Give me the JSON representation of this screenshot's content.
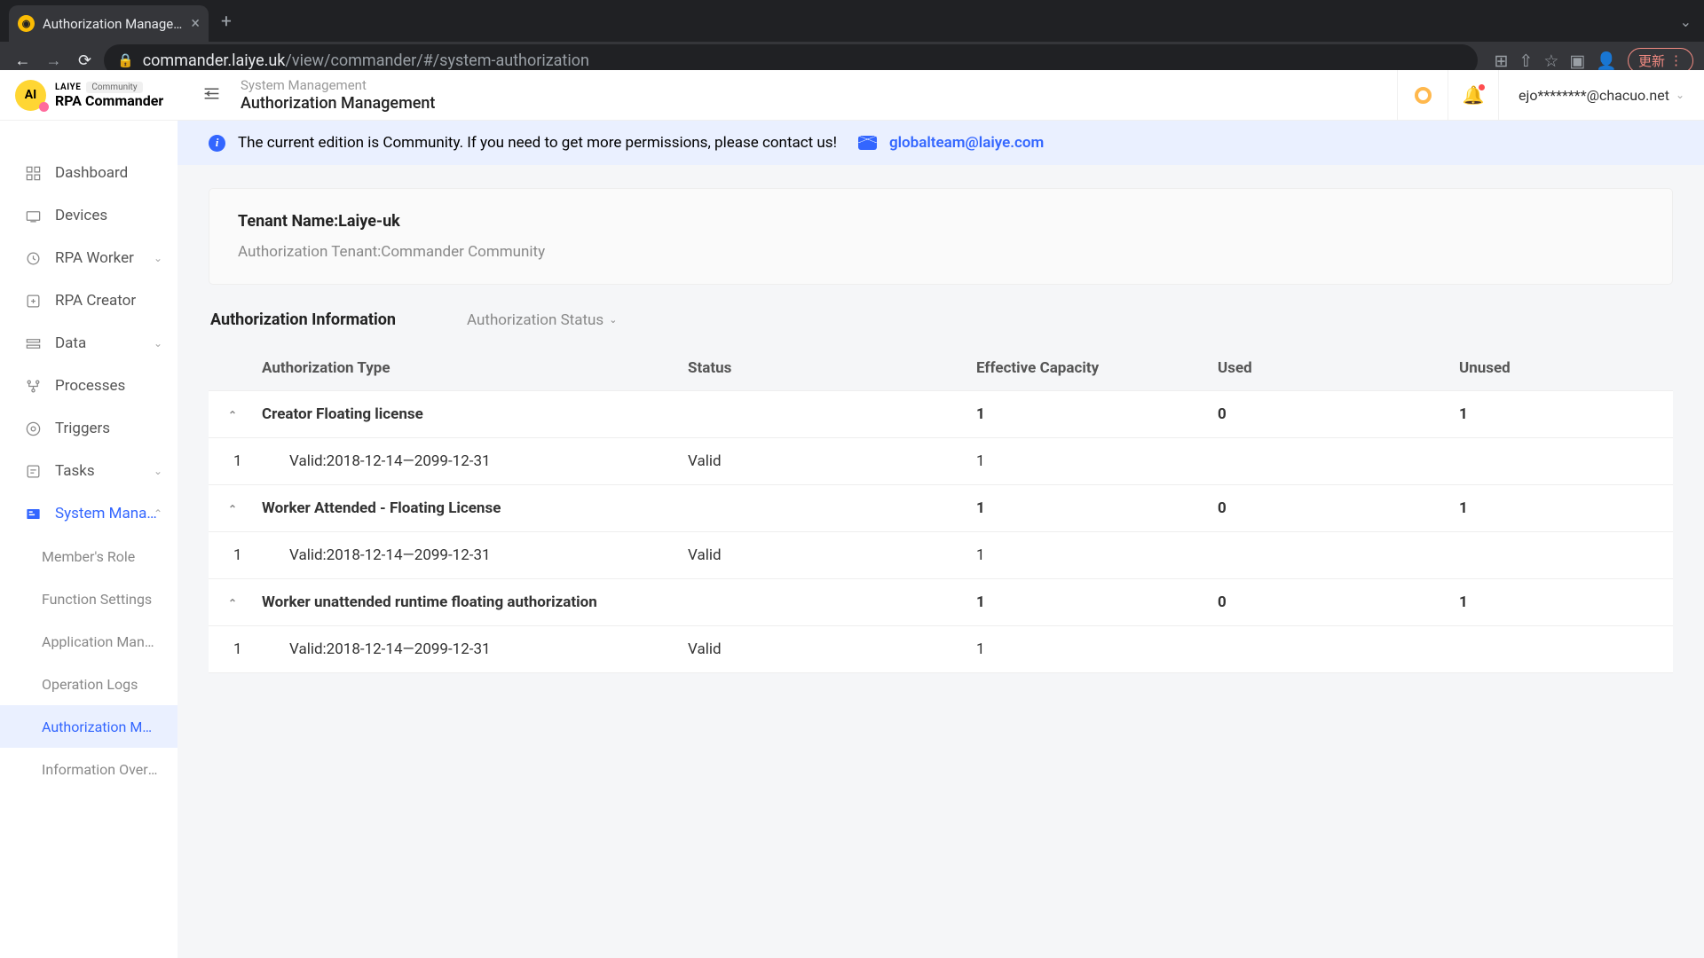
{
  "browser": {
    "tab_title": "Authorization Management_RP",
    "url_domain": "commander.laiye.uk",
    "url_path": "/view/commander/#/system-authorization",
    "update_label": "更新"
  },
  "header": {
    "logo_top": "LAIYE",
    "logo_badge": "Community",
    "logo_name": "RPA Commander",
    "breadcrumb": "System Management",
    "page_title": "Authorization Management",
    "user_email": "ejo********@chacuo.net"
  },
  "sidebar": {
    "items": [
      {
        "label": "Dashboard",
        "icon": "dashboard"
      },
      {
        "label": "Devices",
        "icon": "devices"
      },
      {
        "label": "RPA Worker",
        "icon": "worker",
        "expandable": true
      },
      {
        "label": "RPA Creator",
        "icon": "creator"
      },
      {
        "label": "Data",
        "icon": "data",
        "expandable": true
      },
      {
        "label": "Processes",
        "icon": "processes"
      },
      {
        "label": "Triggers",
        "icon": "triggers"
      },
      {
        "label": "Tasks",
        "icon": "tasks",
        "expandable": true
      },
      {
        "label": "System Manag...",
        "icon": "system",
        "expandable": true,
        "expanded": true
      }
    ],
    "sub_items": [
      {
        "label": "Member's Role"
      },
      {
        "label": "Function Settings"
      },
      {
        "label": "Application Manag..."
      },
      {
        "label": "Operation Logs"
      },
      {
        "label": "Authorization Man...",
        "active": true
      },
      {
        "label": "Information Overvi..."
      }
    ]
  },
  "banner": {
    "text": "The current edition is Community. If you need to get more permissions, please contact us!",
    "email": "globalteam@laiye.com"
  },
  "tenant": {
    "name_label": "Tenant Name:",
    "name_value": "Laiye-uk",
    "auth_label": "Authorization Tenant:",
    "auth_value": "Commander Community"
  },
  "tabs": {
    "active": "Authorization Information",
    "filter": "Authorization Status"
  },
  "table": {
    "headers": {
      "type": "Authorization Type",
      "status": "Status",
      "capacity": "Effective Capacity",
      "used": "Used",
      "unused": "Unused"
    },
    "rows": [
      {
        "kind": "group",
        "type": "Creator Floating license",
        "capacity": "1",
        "used": "0",
        "unused": "1"
      },
      {
        "kind": "child",
        "num": "1",
        "type": "Valid:2018-12-14—2099-12-31",
        "status": "Valid",
        "capacity": "1"
      },
      {
        "kind": "group",
        "type": "Worker Attended - Floating License",
        "capacity": "1",
        "used": "0",
        "unused": "1"
      },
      {
        "kind": "child",
        "num": "1",
        "type": "Valid:2018-12-14—2099-12-31",
        "status": "Valid",
        "capacity": "1"
      },
      {
        "kind": "group",
        "type": "Worker unattended runtime floating authorization",
        "capacity": "1",
        "used": "0",
        "unused": "1"
      },
      {
        "kind": "child",
        "num": "1",
        "type": "Valid:2018-12-14—2099-12-31",
        "status": "Valid",
        "capacity": "1"
      }
    ]
  }
}
